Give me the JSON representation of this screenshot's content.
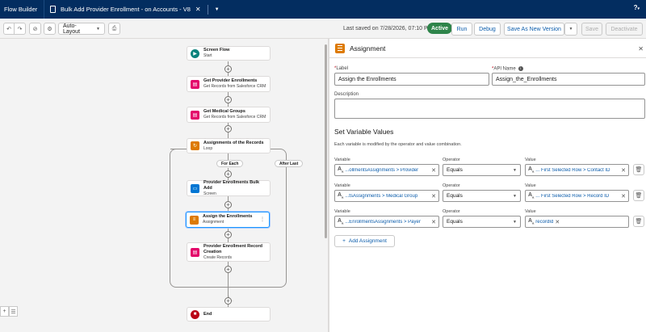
{
  "topbar": {
    "app_name": "Flow Builder",
    "flow_title": "Bulk Add Provider Enrollment - on Accounts - V8",
    "help_label": "?"
  },
  "toolbar": {
    "layout_label": "Auto-Layout",
    "last_saved": "Last saved on 7/28/2026, 07:10 PM",
    "status_badge": "Active",
    "run_label": "Run",
    "debug_label": "Debug",
    "save_as_label": "Save As New Version",
    "save_label": "Save",
    "deactivate_label": "Deactivate"
  },
  "canvas": {
    "nodes": [
      {
        "title": "Screen Flow",
        "subtitle": "Start",
        "color": "#0b827c"
      },
      {
        "title": "Get Provider Enrollments",
        "subtitle": "Get Records from Salesforce CRM",
        "color": "#e3066a"
      },
      {
        "title": "Get Medical Groups",
        "subtitle": "Get Records from Salesforce CRM",
        "color": "#e3066a"
      },
      {
        "title": "Assignments of the Records",
        "subtitle": "Loop",
        "color": "#dd7a01"
      },
      {
        "title": "Provider Enrollments Bulk Add",
        "subtitle": "Screen",
        "color": "#0176d3"
      },
      {
        "title": "Assign the Enrollments",
        "subtitle": "Assignment",
        "color": "#dd7a01"
      },
      {
        "title": "Provider Enrollment Record Creation",
        "subtitle": "Create Records",
        "color": "#e3066a"
      },
      {
        "title": "End",
        "subtitle": "",
        "color": "#ba0517"
      }
    ],
    "for_each_label": "For Each",
    "after_last_label": "After Last"
  },
  "panel": {
    "title": "Assignment",
    "label_field": {
      "label": "Label",
      "value": "Assign the Enrollments"
    },
    "api_name_field": {
      "label": "API Name",
      "value": "Assign_the_Enrollments"
    },
    "description_field": {
      "label": "Description",
      "value": ""
    },
    "section_title": "Set Variable Values",
    "section_desc": "Each variable is modified by the operator and value combination.",
    "col_variable": "Variable",
    "col_operator": "Operator",
    "col_value": "Value",
    "rows": [
      {
        "variable": "...ollmentsAssignments > Provider",
        "operator": "Equals",
        "value": "... First Selected Row > Contact ID"
      },
      {
        "variable": "...tsAssignments > Medical Group",
        "operator": "Equals",
        "value": "... First Selected Row > Record ID"
      },
      {
        "variable": "...EnrollmentsAssignments > Payer",
        "operator": "Equals",
        "value": "recordId"
      }
    ],
    "add_label": "Add Assignment"
  }
}
